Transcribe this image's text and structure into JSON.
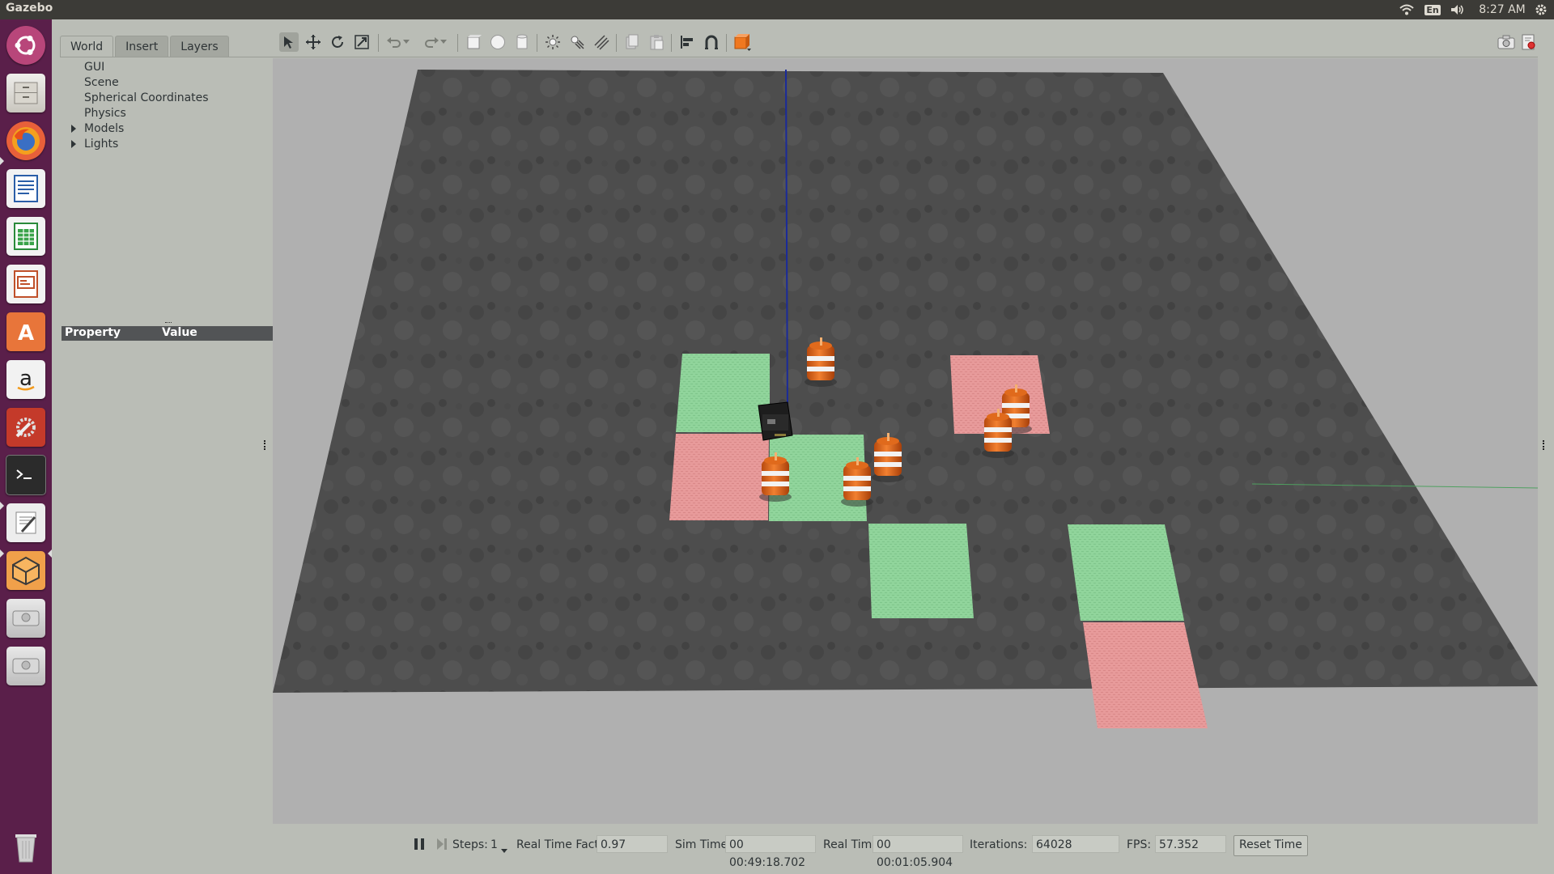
{
  "app": {
    "title": "Gazebo"
  },
  "tray": {
    "keyboard": "En",
    "time": "8:27 AM"
  },
  "launcher": {
    "items": [
      "dash",
      "files",
      "firefox",
      "writer",
      "calc",
      "impress",
      "software-center",
      "amazon",
      "system-settings",
      "terminal",
      "text-editor",
      "gazebo",
      "drive-1",
      "drive-2",
      "trash"
    ]
  },
  "left_panel": {
    "tabs": [
      "World",
      "Insert",
      "Layers"
    ],
    "tree": [
      "GUI",
      "Scene",
      "Spherical Coordinates",
      "Physics",
      "Models",
      "Lights"
    ],
    "property_header": "Property",
    "value_header": "Value"
  },
  "status": {
    "steps_label": "Steps:",
    "steps_value": "1",
    "rtf_label": "Real Time Factor:",
    "rtf_value": "0.97",
    "sim_time_label": "Sim Time:",
    "sim_time_value": "00 00:49:18.702",
    "real_time_label": "Real Time:",
    "real_time_value": "00 00:01:05.904",
    "iterations_label": "Iterations:",
    "iterations_value": "64028",
    "fps_label": "FPS:",
    "fps_value": "57.352",
    "reset_label": "Reset Time"
  },
  "colors": {
    "launcher_bg": "#5a1f4a",
    "ground": "#4a4a4a",
    "green_tile": "#8fd49c",
    "red_tile": "#e89a9a",
    "cone": "#e06a1c"
  }
}
